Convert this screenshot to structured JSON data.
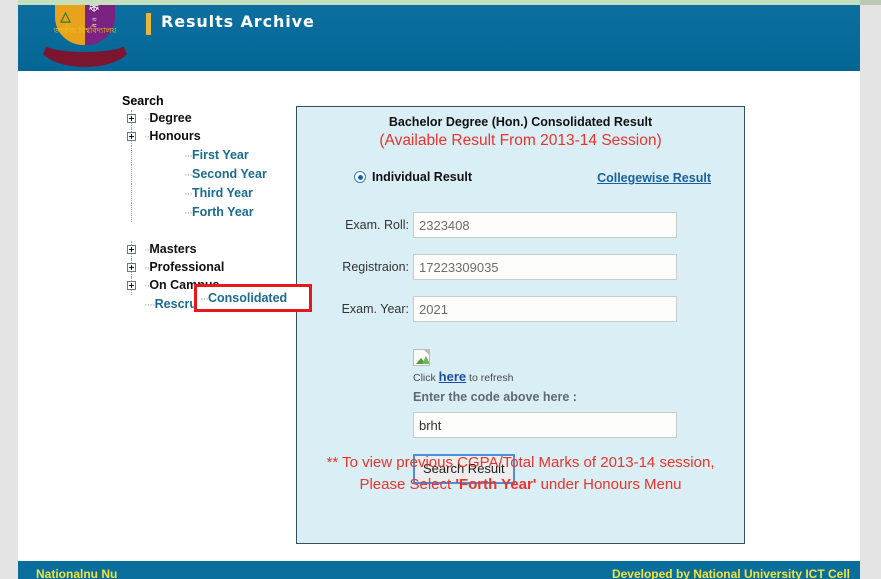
{
  "header": {
    "title": "Results Archive",
    "logo_alt": "National University Bangladesh Emblem",
    "ribbon_text": "জাতীয় বিশ্ববিদ্যালয়"
  },
  "sidebar": {
    "root_label": "Search",
    "nodes": [
      {
        "label": "Degree",
        "type": "expandable"
      },
      {
        "label": "Honours",
        "type": "expandable"
      }
    ],
    "honours_children": [
      {
        "label": "First Year"
      },
      {
        "label": "Second Year"
      },
      {
        "label": "Third Year"
      },
      {
        "label": "Forth Year"
      },
      {
        "label": "Consolidated",
        "selected": true
      }
    ],
    "nodes_after": [
      {
        "label": "Masters",
        "type": "expandable"
      },
      {
        "label": "Professional",
        "type": "expandable"
      },
      {
        "label": "On Campus",
        "type": "expandable"
      }
    ],
    "leaf_links": [
      {
        "label": "Rescrutiny Result"
      }
    ]
  },
  "panel": {
    "title": "Bachelor Degree (Hon.) Consolidated Result",
    "subtitle": "(Available Result From 2013-14 Session)",
    "mode_radio_label": "Individual Result",
    "collegewise_link": "Collegewise Result",
    "fields": [
      {
        "label": "Exam. Roll:",
        "value": "2323408",
        "placeholder": ""
      },
      {
        "label": "Registraion:",
        "value": "17223309035",
        "placeholder": ""
      },
      {
        "label": "Exam. Year:",
        "value": "2021",
        "placeholder": ""
      }
    ],
    "captcha": {
      "image_alt": "captcha-image-broken",
      "refresh_prefix": "Click ",
      "refresh_link": "here",
      "refresh_suffix": " to refresh",
      "prompt": "Enter the code above here :",
      "value": "brht",
      "placeholder": ""
    },
    "submit_label": "Search Result",
    "notice": {
      "line1_a": "** To view previous CGPA/Total Marks of 2013-14",
      "line2_a": "session, Please Select ",
      "line2_b": "'Forth Year'",
      "line2_c": " under Honours",
      "line3": "Menu"
    }
  },
  "footer": {
    "left": "Nationalnu Nu",
    "right": "Developed by National University ICT Cell"
  },
  "colors": {
    "header_blue": "#0a6e9d",
    "accent_yellow": "#e9b53a",
    "panel_bg": "#daeef5",
    "notice_red": "#e8342c",
    "link_blue": "#1a6b8f",
    "highlight_red": "#e8191b"
  }
}
